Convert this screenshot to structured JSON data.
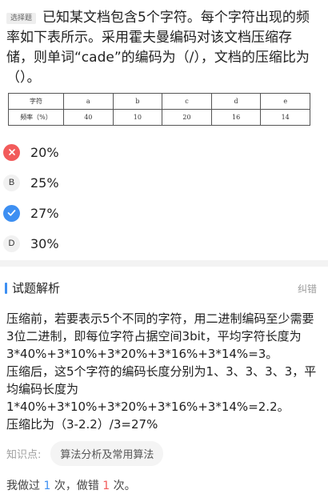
{
  "question": {
    "tag": "选择题",
    "text": "已知某文档包含5个字符。每个字符出现的频率如下表所示。采用霍夫曼编码对该文档压缩存储，则单词“cade”的编码为（/），文档的压缩比为（）。",
    "table": {
      "header": [
        "字符",
        "a",
        "b",
        "c",
        "d",
        "e"
      ],
      "row": [
        "频率（%）",
        "40",
        "10",
        "20",
        "16",
        "14"
      ]
    }
  },
  "options": [
    {
      "letter": "A",
      "text": "20%",
      "state": "wrong",
      "icon": "cross-icon"
    },
    {
      "letter": "B",
      "text": "25%",
      "state": "normal",
      "icon": ""
    },
    {
      "letter": "C",
      "text": "27%",
      "state": "correct",
      "icon": "check-icon"
    },
    {
      "letter": "D",
      "text": "30%",
      "state": "normal",
      "icon": ""
    }
  ],
  "analysis": {
    "title": "试题解析",
    "correction": "纠错",
    "paragraphs": [
      "压缩前，若要表示5个不同的字符，用二进制编码至少需要3位二进制，即每位字符占据空间3bit，平均字符长度为3*40%+3*10%+3*20%+3*16%+3*14%=3。",
      "压缩后，这5个字符的编码长度分别为1、3、3、3、3，平均编码长度为1*40%+3*10%+3*20%+3*16%+3*14%=2.2。",
      "压缩比为（3-2.2）/3=27%"
    ],
    "knowledge_label": "知识点:",
    "knowledge_chip": "算法分析及常用算法",
    "stats": {
      "prefix": "我做过",
      "done": "1",
      "mid": "次，做错",
      "wrong": "1",
      "suffix": "次。"
    }
  },
  "colors": {
    "accent": "#3d8ff2",
    "wrong": "#f25b5b"
  }
}
